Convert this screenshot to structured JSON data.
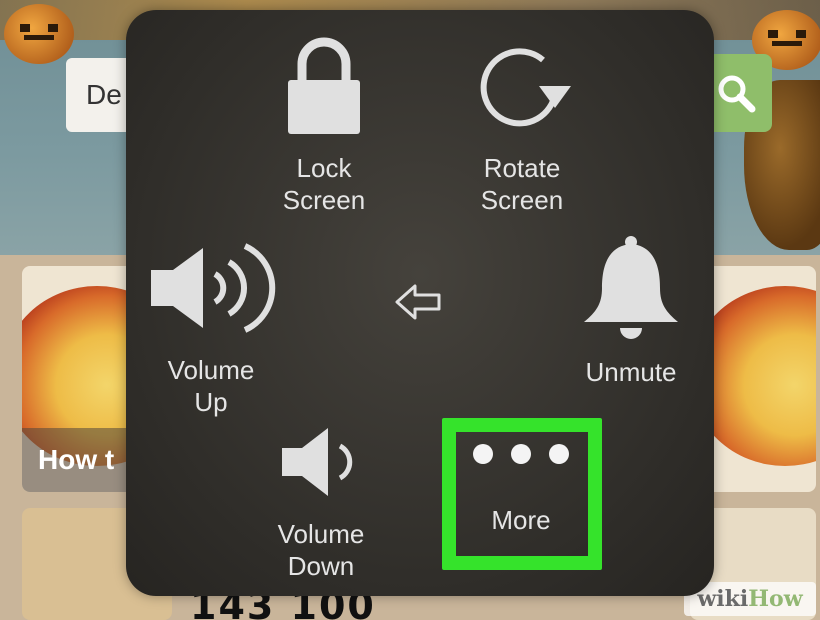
{
  "background": {
    "search_text": "De",
    "card_caption": "How t",
    "note_text": "143 100",
    "watermark": {
      "part1": "wiki",
      "part2": "How"
    }
  },
  "menu": {
    "lock_label": "Lock\nScreen",
    "rotate_label": "Rotate\nScreen",
    "volume_up_label": "Volume\nUp",
    "unmute_label": "Unmute",
    "volume_down_label": "Volume\nDown",
    "more_label": "More"
  },
  "colors": {
    "highlight": "#35e32b",
    "icon": "#e0e0e0",
    "search_button": "#8fbe6a"
  }
}
